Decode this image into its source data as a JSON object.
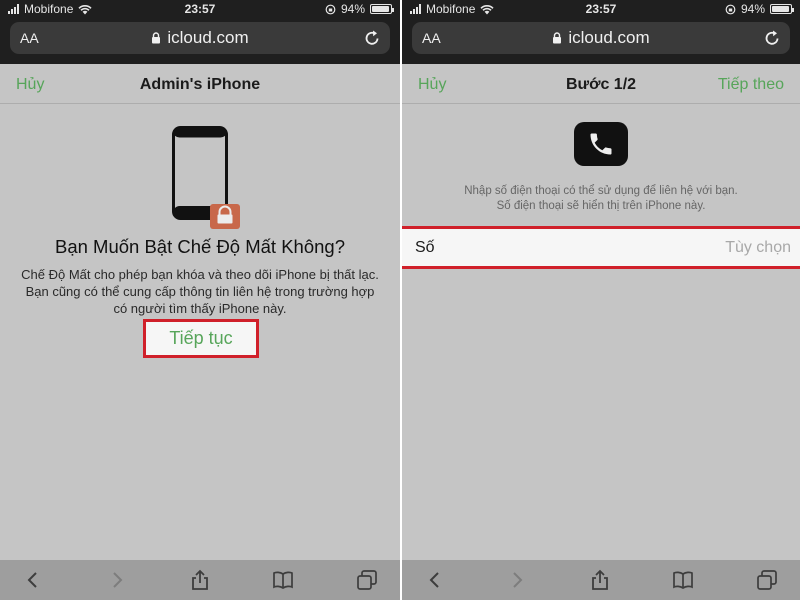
{
  "status_bar": {
    "carrier": "Mobifone",
    "time": "23:57",
    "battery": "94%",
    "battery_level": 0.94
  },
  "address_bar": {
    "text_size": "AA",
    "domain": "icloud.com"
  },
  "lost_mode": {
    "nav": {
      "cancel": "Hủy",
      "title": "Admin's iPhone"
    },
    "heading": "Bạn Muốn Bật Chế Độ Mất Không?",
    "description": "Chế Độ Mất cho phép bạn khóa và theo dõi iPhone bị thất lạc. Bạn cũng có thể cung cấp thông tin liên hệ trong trường hợp có người tìm thấy iPhone này.",
    "continue_button": "Tiếp tục",
    "icons": [
      "phone-lock-icon"
    ]
  },
  "step_one": {
    "nav": {
      "cancel": "Hủy",
      "title": "Bước 1/2",
      "next": "Tiếp theo"
    },
    "hint_line1": "Nhập số điện thoại có thể sử dụng để liên hệ với bạn.",
    "hint_line2": "Số điện thoại sẽ hiển thị trên iPhone này.",
    "field_label": "Số",
    "field_placeholder": "Tùy chọn",
    "field_value": "",
    "icons": [
      "phone-icon"
    ]
  },
  "toolbar_icons": [
    "back-icon",
    "forward-icon",
    "share-icon",
    "bookmarks-icon",
    "tabs-icon"
  ],
  "colors": {
    "accent_green": "#57a55a",
    "highlight_red": "#d0202a",
    "lock_badge": "#c8684a",
    "background": "#c5c5c5"
  }
}
